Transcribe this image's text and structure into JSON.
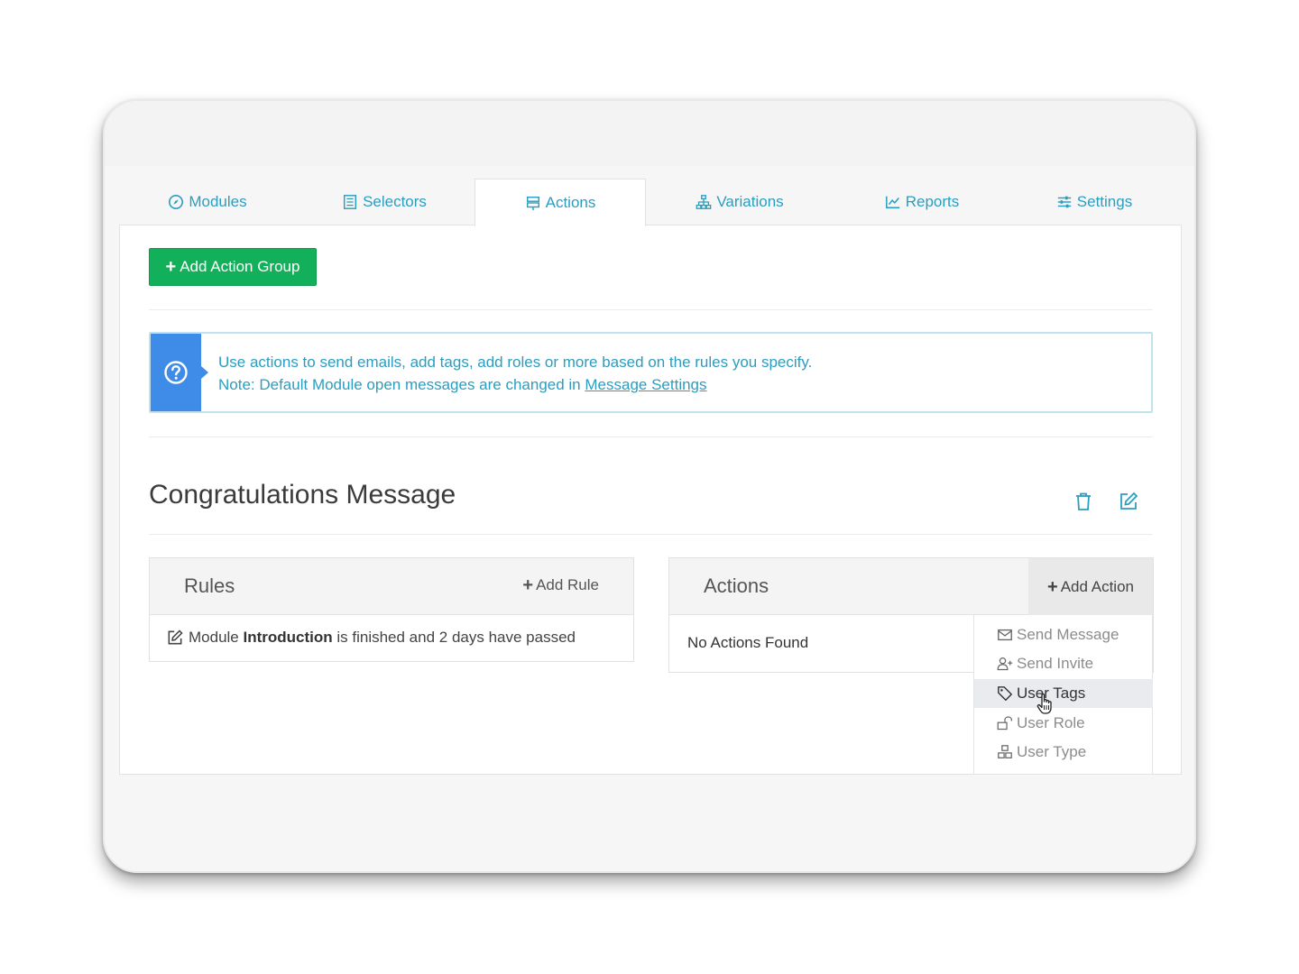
{
  "tabs": [
    {
      "label": "Modules",
      "icon": "compass-icon"
    },
    {
      "label": "Selectors",
      "icon": "list-icon"
    },
    {
      "label": "Actions",
      "icon": "signpost-icon",
      "active": true
    },
    {
      "label": "Variations",
      "icon": "sitemap-icon"
    },
    {
      "label": "Reports",
      "icon": "line-chart-icon"
    },
    {
      "label": "Settings",
      "icon": "sliders-icon"
    }
  ],
  "toolbar": {
    "add_group_label": "Add Action Group",
    "add_group_icon": "plus-icon"
  },
  "info": {
    "icon": "question-circle-icon",
    "line1": "Use actions to send emails, add tags, add roles or more based on the rules you specify.",
    "line2_prefix": "Note: Default Module open messages are changed in ",
    "line2_link": "Message Settings"
  },
  "group": {
    "title": "Congratulations Message",
    "delete_icon": "trash-icon",
    "edit_icon": "edit-icon"
  },
  "rules": {
    "title": "Rules",
    "add_label": "Add Rule",
    "items": [
      {
        "prefix": "Module ",
        "bold": "Introduction",
        "suffix": " is finished and 2 days have passed",
        "icon": "edit-icon"
      }
    ]
  },
  "actions": {
    "title": "Actions",
    "add_label": "Add Action",
    "empty_text": "No Actions Found",
    "menu": [
      {
        "label": "Send Message",
        "icon": "envelope-icon"
      },
      {
        "label": "Send Invite",
        "icon": "user-plus-icon"
      },
      {
        "label": "User Tags",
        "icon": "tag-icon",
        "hovered": true
      },
      {
        "label": "User Role",
        "icon": "unlock-icon"
      },
      {
        "label": "User Type",
        "icon": "cubes-icon"
      }
    ]
  },
  "colors": {
    "accent": "#2a9ec1",
    "primary_button": "#12b05a",
    "info_icon_bg": "#3f8ce8",
    "info_border": "#bfe2ee"
  }
}
